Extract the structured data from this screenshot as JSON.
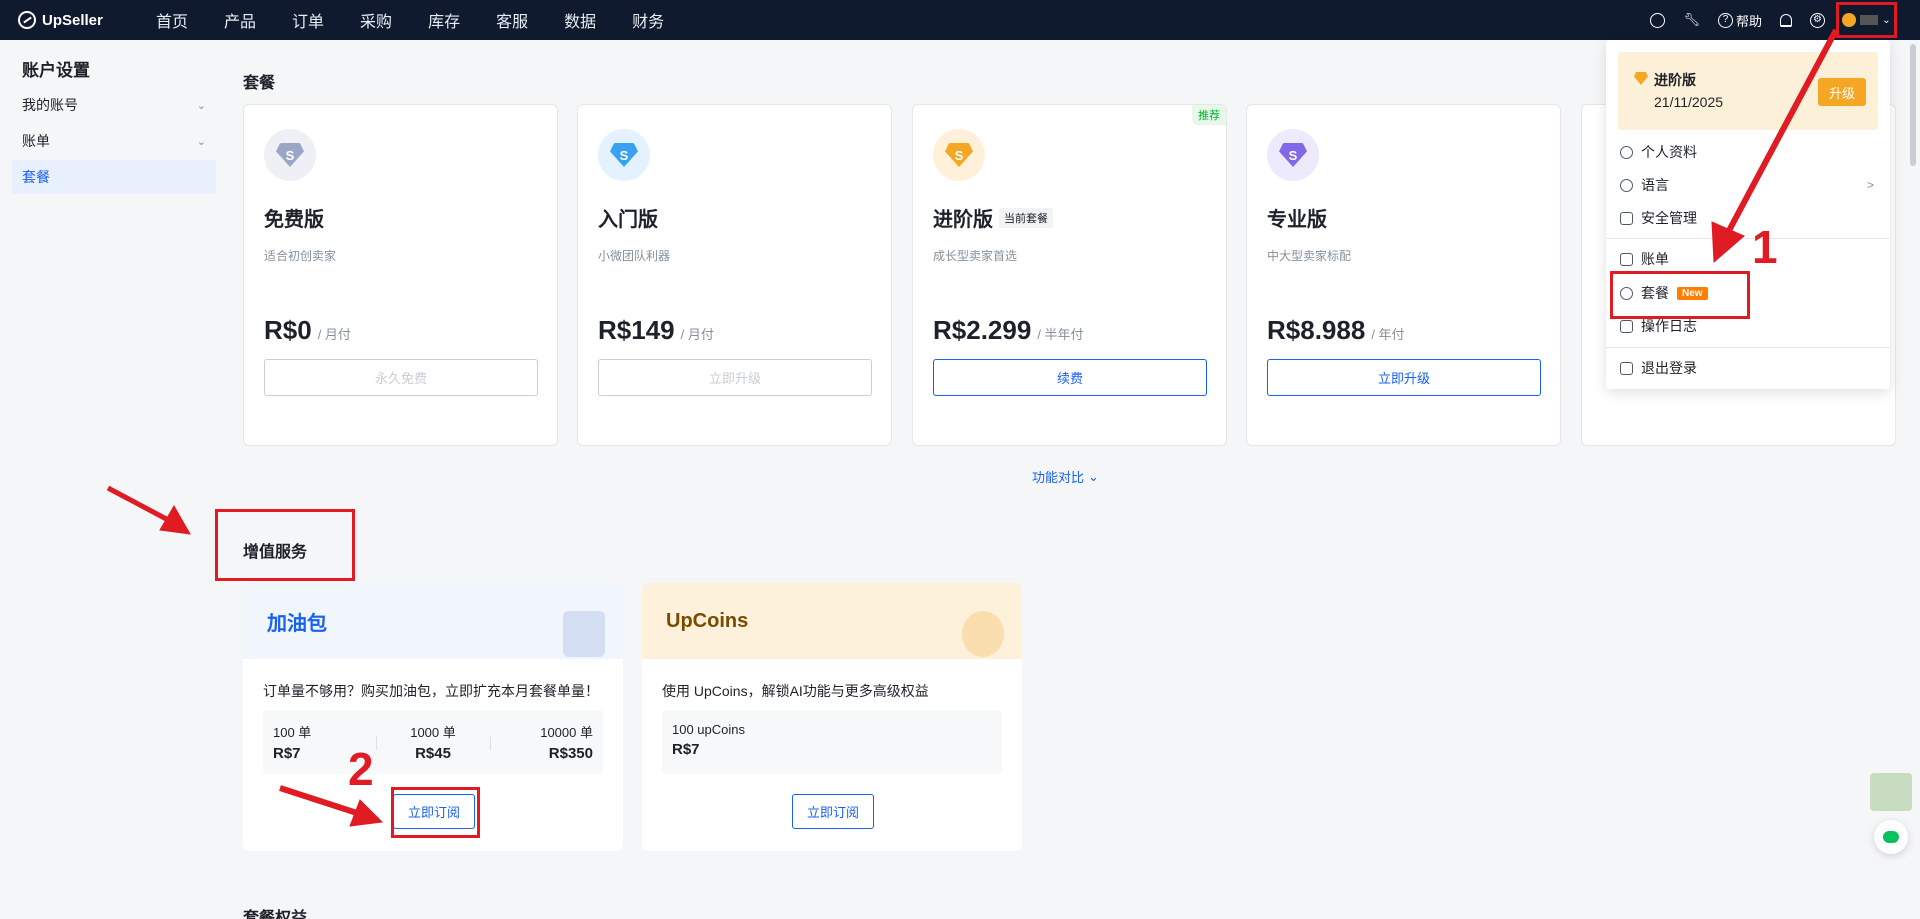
{
  "nav": {
    "brand": "UpSeller",
    "menu": [
      "首页",
      "产品",
      "订单",
      "采购",
      "库存",
      "客服",
      "数据",
      "财务"
    ],
    "help_label": "帮助"
  },
  "sidebar": {
    "title": "账户设置",
    "items": [
      {
        "label": "我的账号",
        "has_chevron": true
      },
      {
        "label": "账单",
        "has_chevron": true
      },
      {
        "label": "套餐",
        "active": true
      }
    ]
  },
  "plans_section": {
    "title": "套餐",
    "compare_label": "功能对比",
    "plans": [
      {
        "name": "免费版",
        "desc": "适合初创卖家",
        "price": "R$0",
        "period": "/ 月付",
        "button": "永久免费",
        "icon_color": "#9aa6c8",
        "icon_bg": "#eef0f6"
      },
      {
        "name": "入门版",
        "desc": "小微团队利器",
        "price": "R$149",
        "period": "/ 月付",
        "button": "立即升级",
        "icon_color": "#3aa0f0",
        "icon_bg": "#e3f2fe"
      },
      {
        "name": "进阶版",
        "tag": "当前套餐",
        "badge": "推荐",
        "desc": "成长型卖家首选",
        "price": "R$2.299",
        "period": "/ 半年付",
        "button": "续费",
        "icon_color": "#f5a623",
        "icon_bg": "#fff1d9"
      },
      {
        "name": "专业版",
        "desc": "中大型卖家标配",
        "price": "R$8.988",
        "period": "/ 年付",
        "button": "立即升级",
        "icon_color": "#8168e8",
        "icon_bg": "#eeeafd"
      }
    ]
  },
  "vas": {
    "title": "增值服务",
    "fuel": {
      "title": "加油包",
      "desc": "订单量不够用？购买加油包，立即扩充本月套餐单量！",
      "options": [
        {
          "qty": "100 单",
          "price": "R$7"
        },
        {
          "qty": "1000 单",
          "price": "R$45"
        },
        {
          "qty": "10000 单",
          "price": "R$350"
        }
      ],
      "button": "立即订阅"
    },
    "coins": {
      "title": "UpCoins",
      "desc": "使用 UpCoins，解锁AI功能与更多高级权益",
      "option": {
        "qty": "100 upCoins",
        "price": "R$7"
      },
      "button": "立即订阅"
    }
  },
  "benefits_title": "套餐权益",
  "dropdown": {
    "plan_name": "进阶版",
    "plan_date": "21/11/2025",
    "upgrade_label": "升级",
    "items": [
      "个人资料",
      "语言",
      "安全管理",
      "账单",
      "套餐",
      "操作日志",
      "退出登录"
    ],
    "new_tag": "New"
  },
  "annotations": {
    "step1": "1",
    "step2": "2"
  },
  "colors": {
    "accent": "#1760f2",
    "nav_bg": "#0f1a2e",
    "annotation": "#e01b24",
    "gold": "#f5a623"
  }
}
